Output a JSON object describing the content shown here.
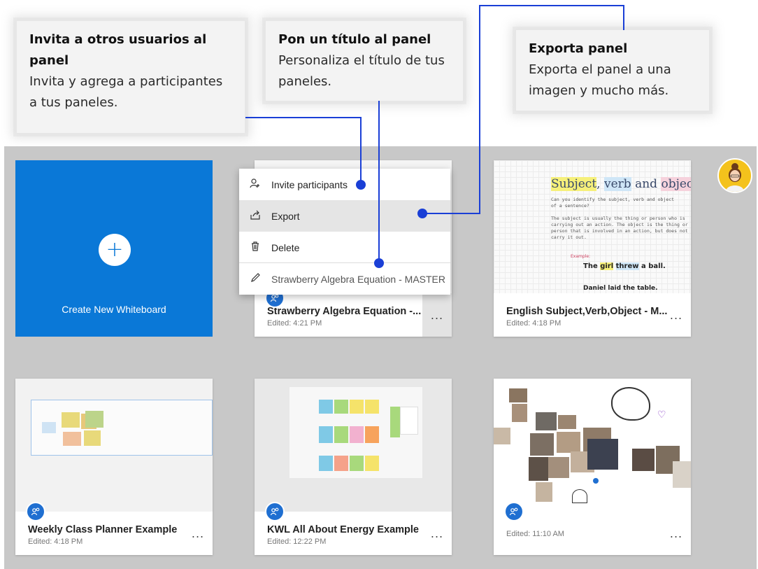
{
  "callouts": {
    "invite": {
      "title": "Invita a otros usuarios al panel",
      "desc": "Invita y agrega a participantes a tus paneles."
    },
    "title": {
      "title": "Pon un título al panel",
      "desc": "Personaliza el título de tus paneles."
    },
    "export": {
      "title": "Exporta panel",
      "desc": "Exporta el panel a una imagen y mucho más."
    }
  },
  "create": {
    "label": "Create New Whiteboard"
  },
  "menu": {
    "invite": "Invite participants",
    "export": "Export",
    "delete": "Delete",
    "rename": "Strawberry Algebra Equation - MASTER"
  },
  "cards": [
    {
      "title": "Strawberry Algebra Equation -...",
      "edited": "Edited: 4:21 PM"
    },
    {
      "title": "English Subject,Verb,Object - M...",
      "edited": "Edited: 4:18 PM"
    },
    {
      "title": "Weekly Class Planner Example",
      "edited": "Edited: 4:18 PM"
    },
    {
      "title": "KWL All About Energy Example",
      "edited": "Edited: 12:22 PM"
    },
    {
      "title": "",
      "edited": "Edited: 11:10 AM"
    }
  ],
  "more_label": "...",
  "english_thumb": {
    "heading_subject": "Subject",
    "heading_comma": ",",
    "heading_verb": "verb",
    "heading_and": "and",
    "heading_object": "object",
    "line1": "Can you identify the subject, verb and object",
    "line2": "of a sentence?",
    "line3": "The subject is usually the thing or person who is",
    "line4": "carrying out an action. The object is the thing or",
    "line5": "person that is involved in an action, but does not",
    "line6": "carry it out.",
    "example": "Example:",
    "ex_the": "The",
    "ex_girl": "girl",
    "ex_threw": "threw",
    "ex_aball": "a ball.",
    "ex2": "Daniel laid the table."
  },
  "colors": {
    "accent": "#0a78d7",
    "badge": "#1f6fd1",
    "connector": "#1a3fd6",
    "background": "#c8c8c8"
  },
  "icons": {
    "invite": "person-add-icon",
    "export": "share-icon",
    "delete": "trash-icon",
    "rename": "pencil-icon",
    "create": "plus-icon",
    "badge": "participants-icon"
  }
}
